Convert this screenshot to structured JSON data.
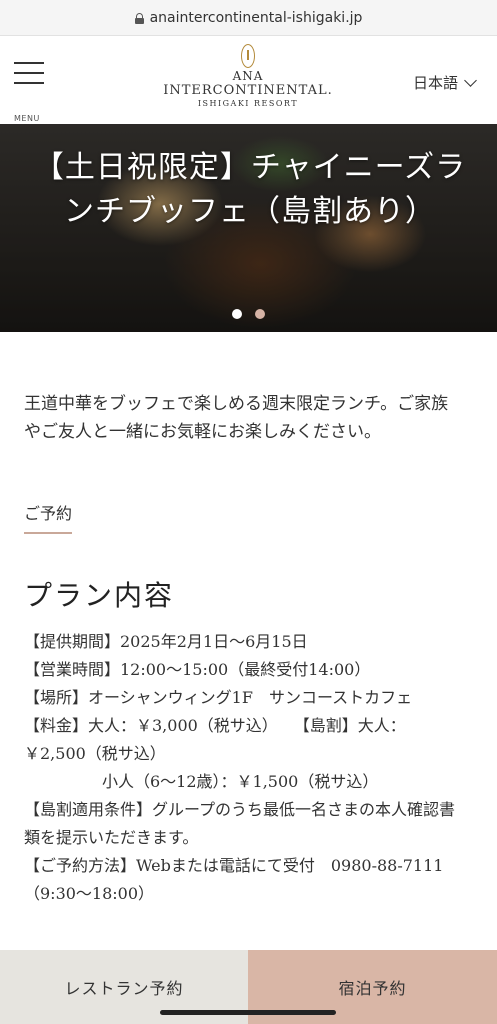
{
  "browser": {
    "url": "anaintercontinental-ishigaki.jp"
  },
  "header": {
    "menu_label": "MENU",
    "logo_line1": "ANA",
    "logo_line2": "INTERCONTINENTAL.",
    "logo_line3": "ISHIGAKI RESORT",
    "language": "日本語"
  },
  "hero": {
    "title": "【土日祝限定】チャイニーズランチブッフェ（島割あり）",
    "slides": 2,
    "active_slide": 1
  },
  "content": {
    "intro": "王道中華をブッフェで楽しめる週末限定ランチ。ご家族やご友人と一緒にお気軽にお楽しみください。",
    "reserve_link": "ご予約",
    "plan_title": "プラン内容",
    "plan_lines": [
      "【提供期間】2025年2月1日～6月15日",
      "【営業時間】12:00～15:00（最終受付14:00）",
      "【場所】オーシャンウィング1F　サンコーストカフェ",
      "【料金】大人：￥3,000（税サ込）　　【島割】大人：￥2,500（税サ込）",
      "小人（6～12歳）：￥1,500（税サ込）",
      "【島割適用条件】グループのうち最低一名さまの本人確認書類を提示いただきます。",
      "【ご予約方法】Webまたは電話にて受付　0980-88-7111（9:30～18:00）"
    ]
  },
  "bottom_bar": {
    "restaurant_label": "レストラン予約",
    "stay_label": "宿泊予約"
  },
  "colors": {
    "accent_rose": "#d9b6a6",
    "grey_button": "#e6e4df",
    "gold": "#b38a3a",
    "dot_active": "#ffffff",
    "dot_inactive": "#d6b3a5"
  }
}
